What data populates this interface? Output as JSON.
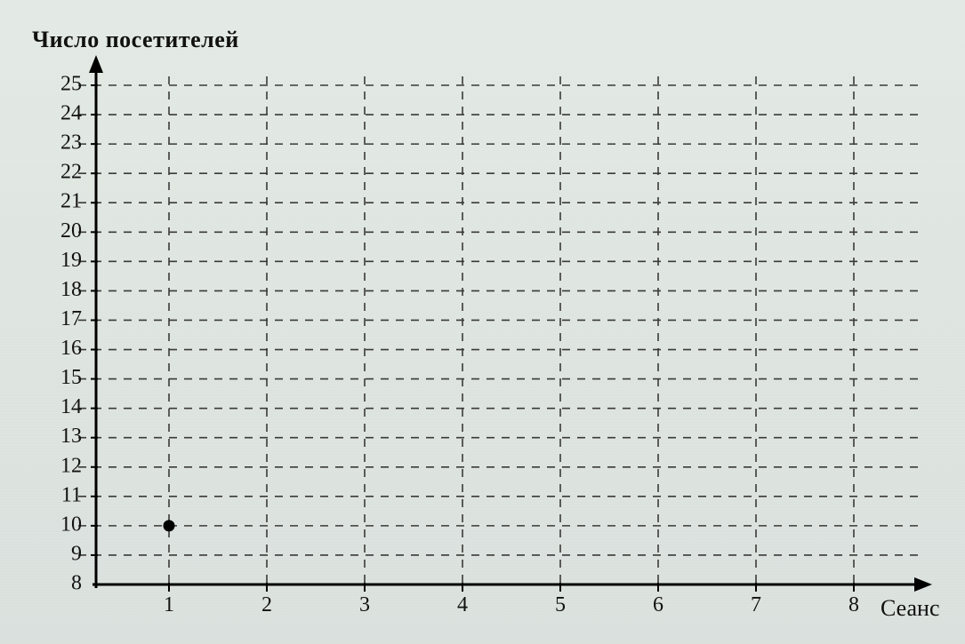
{
  "chart_data": {
    "type": "scatter",
    "title": "",
    "xlabel": "Сеанс",
    "ylabel": "Число посетителей",
    "x": [
      1
    ],
    "y": [
      10
    ],
    "x_ticks": [
      1,
      2,
      3,
      4,
      5,
      6,
      7,
      8
    ],
    "y_ticks": [
      8,
      9,
      10,
      11,
      12,
      13,
      14,
      15,
      16,
      17,
      18,
      19,
      20,
      21,
      22,
      23,
      24,
      25
    ],
    "xlim": [
      0,
      8.8
    ],
    "ylim": [
      8,
      25
    ],
    "grid": true,
    "grid_style": "dashed"
  }
}
